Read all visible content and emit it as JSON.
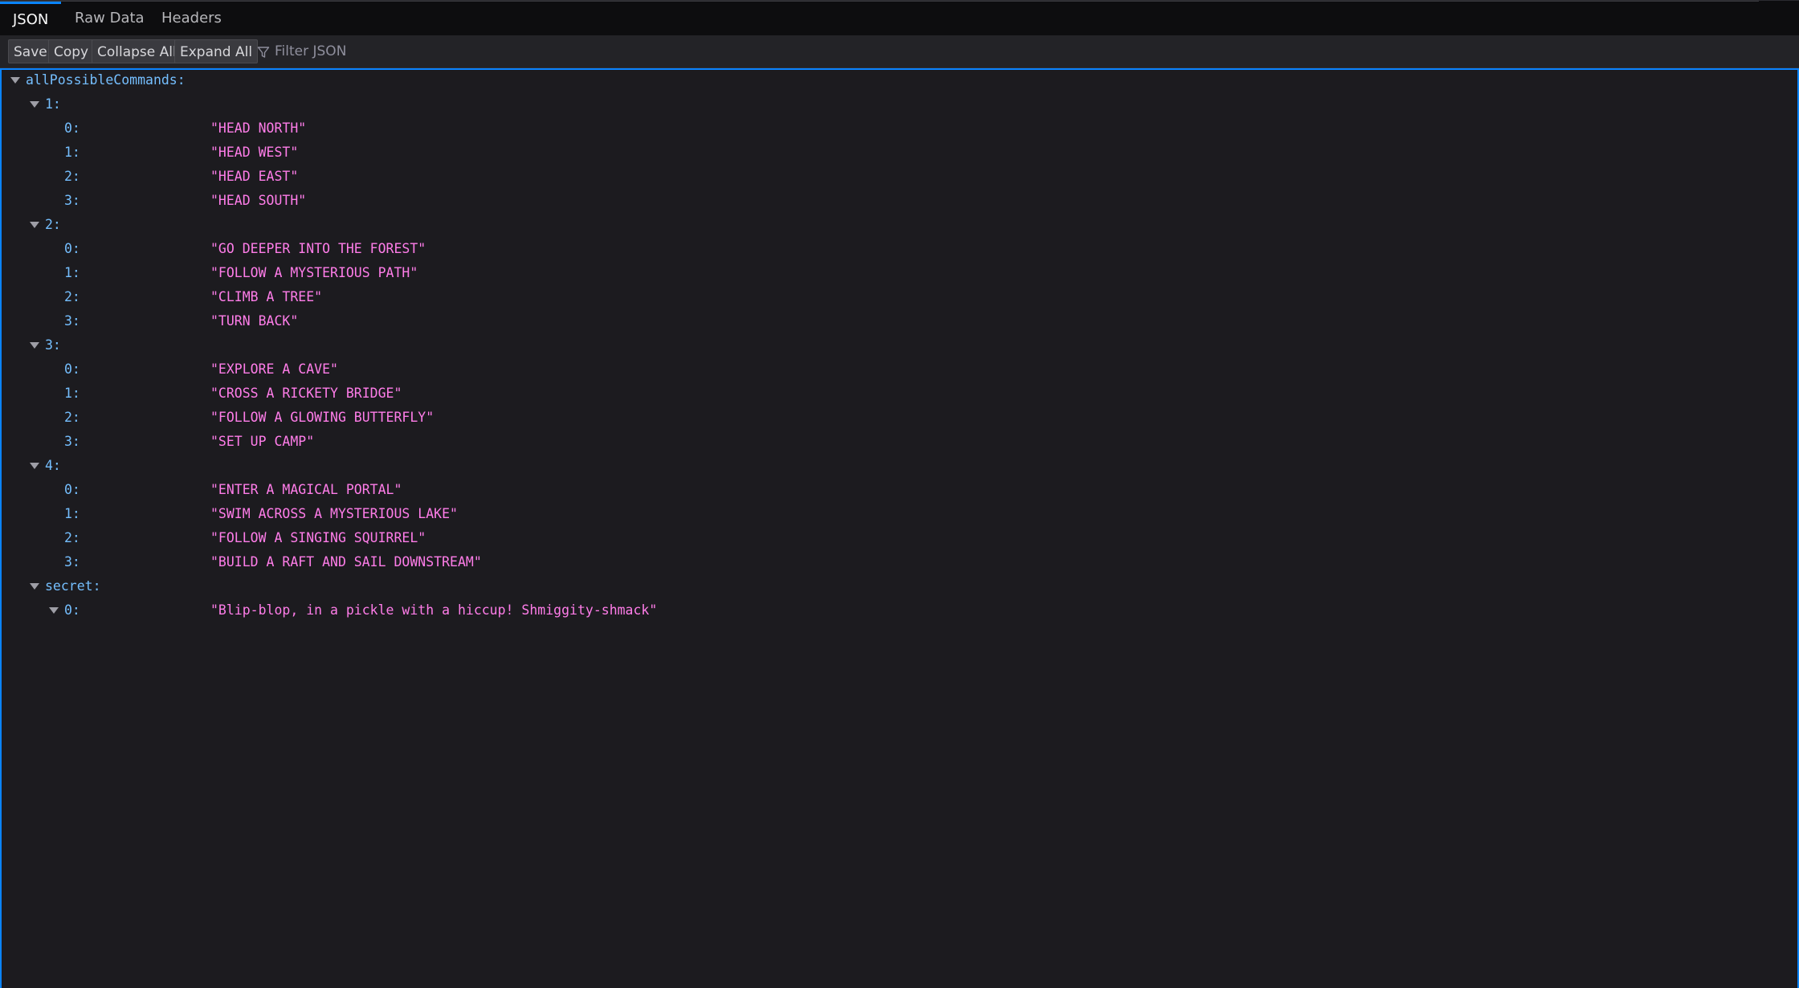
{
  "tabs": [
    "JSON",
    "Raw Data",
    "Headers"
  ],
  "toolbar": {
    "save": "Save",
    "copy": "Copy",
    "collapse_all": "Collapse All",
    "expand_all": "Expand All",
    "filter_placeholder": "Filter JSON"
  },
  "tree": [
    {
      "depth": 0,
      "key": "allPossibleCommands:",
      "toggle": true
    },
    {
      "depth": 1,
      "key": "1:",
      "toggle": true
    },
    {
      "depth": 2,
      "key": "0:",
      "value": "\"HEAD NORTH\""
    },
    {
      "depth": 2,
      "key": "1:",
      "value": "\"HEAD WEST\""
    },
    {
      "depth": 2,
      "key": "2:",
      "value": "\"HEAD EAST\""
    },
    {
      "depth": 2,
      "key": "3:",
      "value": "\"HEAD SOUTH\""
    },
    {
      "depth": 1,
      "key": "2:",
      "toggle": true
    },
    {
      "depth": 2,
      "key": "0:",
      "value": "\"GO DEEPER INTO THE FOREST\""
    },
    {
      "depth": 2,
      "key": "1:",
      "value": "\"FOLLOW A MYSTERIOUS PATH\""
    },
    {
      "depth": 2,
      "key": "2:",
      "value": "\"CLIMB A TREE\""
    },
    {
      "depth": 2,
      "key": "3:",
      "value": "\"TURN BACK\""
    },
    {
      "depth": 1,
      "key": "3:",
      "toggle": true
    },
    {
      "depth": 2,
      "key": "0:",
      "value": "\"EXPLORE A CAVE\""
    },
    {
      "depth": 2,
      "key": "1:",
      "value": "\"CROSS A RICKETY BRIDGE\""
    },
    {
      "depth": 2,
      "key": "2:",
      "value": "\"FOLLOW A GLOWING BUTTERFLY\""
    },
    {
      "depth": 2,
      "key": "3:",
      "value": "\"SET UP CAMP\""
    },
    {
      "depth": 1,
      "key": "4:",
      "toggle": true
    },
    {
      "depth": 2,
      "key": "0:",
      "value": "\"ENTER A MAGICAL PORTAL\""
    },
    {
      "depth": 2,
      "key": "1:",
      "value": "\"SWIM ACROSS A MYSTERIOUS LAKE\""
    },
    {
      "depth": 2,
      "key": "2:",
      "value": "\"FOLLOW A SINGING SQUIRREL\""
    },
    {
      "depth": 2,
      "key": "3:",
      "value": "\"BUILD A RAFT AND SAIL DOWNSTREAM\""
    },
    {
      "depth": 1,
      "key": "secret:",
      "toggle": true
    },
    {
      "depth": 2,
      "key": "0:",
      "value": "\"Blip-blop, in a pickle with a hiccup! Shmiggity-shmack\"",
      "toggle": true
    }
  ],
  "colors": {
    "key": "#75bfff",
    "string": "#ff7de9",
    "accent": "#0a84ff",
    "background": "#1c1b1f"
  }
}
